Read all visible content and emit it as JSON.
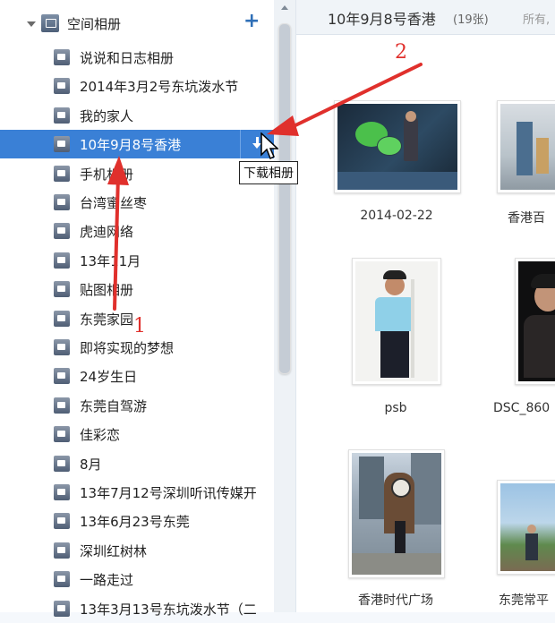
{
  "sidebar": {
    "root_label": "空间相册",
    "add_label": "+",
    "albums": [
      "说说和日志相册",
      "2014年3月2号东坑泼水节",
      "我的家人",
      "10年9月8号香港",
      "手机相册",
      "台湾蜜丝枣",
      "虎迪网络",
      "13年11月",
      "贴图相册",
      "东莞家园",
      "即将实现的梦想",
      "24岁生日",
      "东莞自驾游",
      "佳彩恋",
      "8月",
      "13年7月12号深圳听讯传媒开",
      "13年6月23号东莞",
      "深圳红树林",
      "一路走过",
      "13年3月13号东坑泼水节（二"
    ],
    "selected_index": 3,
    "tooltip": "下载相册"
  },
  "main": {
    "title": "10年9月8号香港",
    "count": "(19张)",
    "hint": "所有,",
    "photos": [
      {
        "caption": "2014-02-22"
      },
      {
        "caption": "香港百"
      },
      {
        "caption": "psb"
      },
      {
        "caption": "DSC_860"
      },
      {
        "caption": "香港时代广场"
      },
      {
        "caption": "东莞常平"
      }
    ]
  },
  "annotations": {
    "arrow1_label": "1",
    "arrow2_label": "2",
    "color": "#e0302c"
  }
}
